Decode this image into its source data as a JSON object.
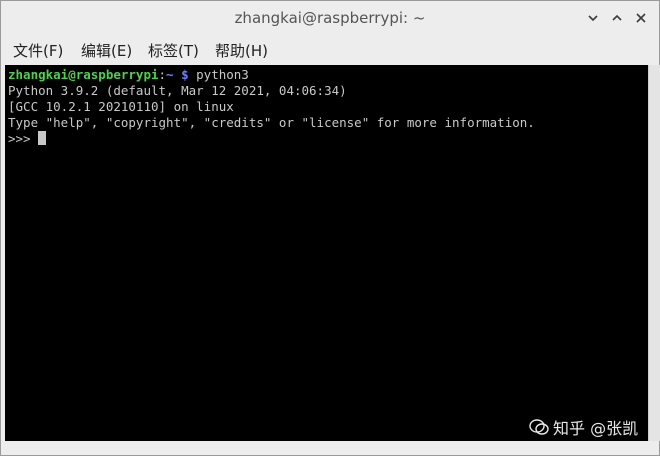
{
  "window": {
    "title": "zhangkai@raspberrypi: ~"
  },
  "menubar": {
    "items": [
      {
        "label": "文件(F)"
      },
      {
        "label": "编辑(E)"
      },
      {
        "label": "标签(T)"
      },
      {
        "label": "帮助(H)"
      }
    ]
  },
  "terminal": {
    "prompt_user": "zhangkai@raspberrypi",
    "prompt_colon": ":",
    "prompt_path": "~ $",
    "command": " python3",
    "lines": [
      "Python 3.9.2 (default, Mar 12 2021, 04:06:34)",
      "[GCC 10.2.1 20210110] on linux",
      "Type \"help\", \"copyright\", \"credits\" or \"license\" for more information."
    ],
    "repl_prompt": ">>> "
  },
  "watermark": {
    "text": "知乎 @张凯"
  },
  "colors": {
    "prompt_user": "#4fd04f",
    "prompt_path": "#6f7fff",
    "terminal_bg": "#000000",
    "terminal_fg": "#c8c8c8"
  }
}
